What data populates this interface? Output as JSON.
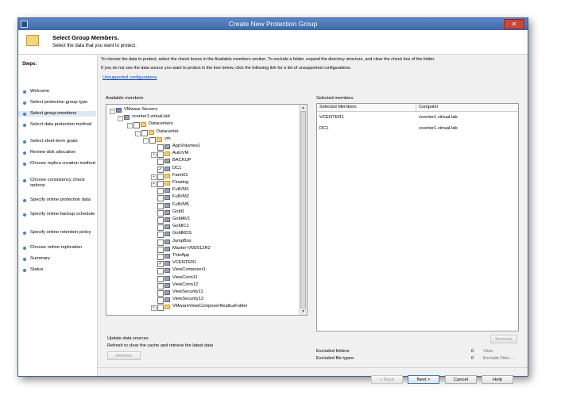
{
  "window": {
    "title": "Create New Protection Group"
  },
  "header": {
    "title": "Select Group Members.",
    "subtitle": "Select the data that you want to protect."
  },
  "steps": {
    "title": "Steps:",
    "items": [
      {
        "label": "Welcome"
      },
      {
        "label": "Select protection group type"
      },
      {
        "label": "Select group members"
      },
      {
        "label": "Select data protection method"
      },
      {
        "label": "Select short-term goals"
      },
      {
        "label": "Review disk allocation"
      },
      {
        "label": "Choose replica creation method"
      },
      {
        "label": "Choose consistency check options"
      },
      {
        "label": "Specify online protection data"
      },
      {
        "label": "Specify online backup schedule"
      },
      {
        "label": "Specify online retention policy"
      },
      {
        "label": "Choose online replication"
      },
      {
        "label": "Summary"
      },
      {
        "label": "Status"
      }
    ]
  },
  "content": {
    "intro_1": "To choose the data to protect, select the check boxes in the Available members section. To exclude a folder, expand the directory structure, and clear the check box of the folder.",
    "intro_2": "If you do not see the data source you want to protect in the tree below, click the following link for a list of unsupported configurations.",
    "link": "Unsupported configurations",
    "available_label": "Available members",
    "selected_label": "Selected members",
    "tree": [
      {
        "label": "VMware Servers",
        "level": 0,
        "expand": "−",
        "icon": "server-icon",
        "checked": false,
        "has_cb": false
      },
      {
        "label": "vcenter1.virtual.lab",
        "level": 1,
        "expand": "−",
        "icon": "vm-icon",
        "checked": false,
        "has_cb": false
      },
      {
        "label": "Datacenters",
        "level": 2,
        "expand": "−",
        "icon": "folder-icon",
        "checked": false,
        "has_cb": true
      },
      {
        "label": "Datacenter",
        "level": 3,
        "expand": "−",
        "icon": "folder-icon",
        "checked": false,
        "has_cb": true
      },
      {
        "label": "vm",
        "level": 4,
        "expand": "−",
        "icon": "folder-icon",
        "checked": false,
        "has_cb": true
      },
      {
        "label": "AppVolumes1",
        "level": 5,
        "expand": "",
        "icon": "vm-icon",
        "checked": false,
        "has_cb": true
      },
      {
        "label": "AutoVM",
        "level": 5,
        "expand": "+",
        "icon": "folder-icon",
        "checked": false,
        "has_cb": true
      },
      {
        "label": "BACKUP",
        "level": 5,
        "expand": "",
        "icon": "vm-icon",
        "checked": false,
        "has_cb": true
      },
      {
        "label": "DC1",
        "level": 5,
        "expand": "",
        "icon": "vm-icon",
        "checked": true,
        "has_cb": true
      },
      {
        "label": "Farm01",
        "level": 5,
        "expand": "+",
        "icon": "folder-icon",
        "checked": false,
        "has_cb": true
      },
      {
        "label": "Floating",
        "level": 5,
        "expand": "+",
        "icon": "folder-icon",
        "checked": false,
        "has_cb": true
      },
      {
        "label": "FullVM1",
        "level": 5,
        "expand": "",
        "icon": "vm-icon",
        "checked": false,
        "has_cb": true
      },
      {
        "label": "FullVM2",
        "level": 5,
        "expand": "",
        "icon": "vm-icon",
        "checked": false,
        "has_cb": true
      },
      {
        "label": "FullVM5",
        "level": 5,
        "expand": "",
        "icon": "vm-icon",
        "checked": false,
        "has_cb": true
      },
      {
        "label": "Gold1",
        "level": 5,
        "expand": "",
        "icon": "vm-icon",
        "checked": false,
        "has_cb": true
      },
      {
        "label": "GoldAV1",
        "level": 5,
        "expand": "",
        "icon": "vm-icon",
        "checked": false,
        "has_cb": true
      },
      {
        "label": "GoldIC1",
        "level": 5,
        "expand": "",
        "icon": "vm-icon",
        "checked": false,
        "has_cb": true
      },
      {
        "label": "GoldRDS",
        "level": 5,
        "expand": "",
        "icon": "vm-icon",
        "checked": false,
        "has_cb": true
      },
      {
        "label": "JumpBox",
        "level": 5,
        "expand": "",
        "icon": "vm-icon",
        "checked": false,
        "has_cb": true
      },
      {
        "label": "Master-VM2012R2",
        "level": 5,
        "expand": "",
        "icon": "vm-icon",
        "checked": false,
        "has_cb": true
      },
      {
        "label": "ThinApp",
        "level": 5,
        "expand": "",
        "icon": "vm-icon",
        "checked": false,
        "has_cb": true
      },
      {
        "label": "VCENTER1",
        "level": 5,
        "expand": "",
        "icon": "vm-icon",
        "checked": true,
        "has_cb": true
      },
      {
        "label": "ViewComposer1",
        "level": 5,
        "expand": "",
        "icon": "vm-icon",
        "checked": false,
        "has_cb": true
      },
      {
        "label": "ViewConn11",
        "level": 5,
        "expand": "",
        "icon": "vm-icon",
        "checked": false,
        "has_cb": true
      },
      {
        "label": "ViewConn12",
        "level": 5,
        "expand": "",
        "icon": "vm-icon",
        "checked": false,
        "has_cb": true
      },
      {
        "label": "ViewSecurity11",
        "level": 5,
        "expand": "",
        "icon": "vm-icon",
        "checked": false,
        "has_cb": true
      },
      {
        "label": "ViewSecurity12",
        "level": 5,
        "expand": "",
        "icon": "vm-icon",
        "checked": false,
        "has_cb": true
      },
      {
        "label": "VMwareViewComposerReplicaFolder",
        "level": 5,
        "expand": "+",
        "icon": "folder-icon",
        "checked": false,
        "has_cb": true
      }
    ],
    "selected_columns": [
      "Selected Members",
      "Computer"
    ],
    "selected_rows": [
      {
        "member": "VCENTER1",
        "computer": "vcenter1.virtual.lab"
      },
      {
        "member": "DC1",
        "computer": "vcenter1.virtual.lab"
      }
    ],
    "remove_label": "Remove",
    "update_title": "Update data sources",
    "update_desc": "Refresh to clear the cache and retrieve the latest data",
    "refresh_label": "Refresh",
    "excluded_folders_label": "Excluded folders:",
    "excluded_folders_count": "0",
    "view_label": "View",
    "excluded_files_label": "Excluded file types:",
    "excluded_files_count": "0",
    "exclude_files_label": "Exclude Files ..."
  },
  "footer": {
    "back": "< Back",
    "next": "Next >",
    "cancel": "Cancel",
    "help": "Help"
  }
}
